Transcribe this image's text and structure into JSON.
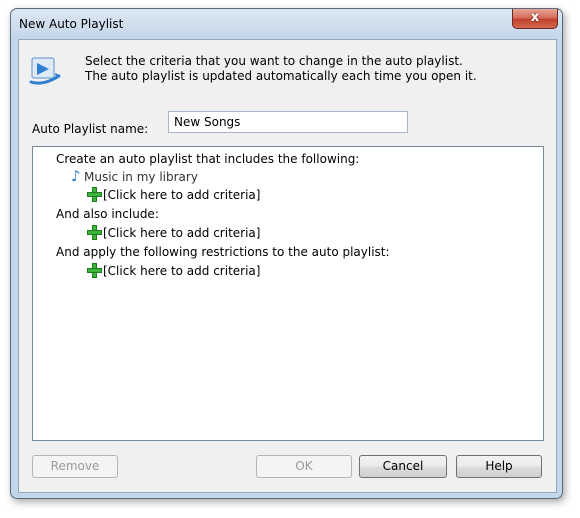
{
  "window": {
    "title": "New Auto Playlist",
    "close_label": "x"
  },
  "header": {
    "line1": "Select the criteria that you want to change in the auto playlist.",
    "line2": "The auto playlist is updated automatically each time you open it."
  },
  "name_field": {
    "label": "Auto Playlist name:",
    "value": "New Songs"
  },
  "criteria": {
    "include_heading": "Create an auto playlist that includes the following:",
    "library_item": "Music in my library",
    "add_criteria_1": "[Click here to add criteria]",
    "also_heading": "And also include:",
    "add_criteria_2": "[Click here to add criteria]",
    "restrict_heading": "And apply the following restrictions to the auto playlist:",
    "add_criteria_3": "[Click here to add criteria]"
  },
  "buttons": {
    "remove": "Remove",
    "ok": "OK",
    "cancel": "Cancel",
    "help": "Help"
  }
}
